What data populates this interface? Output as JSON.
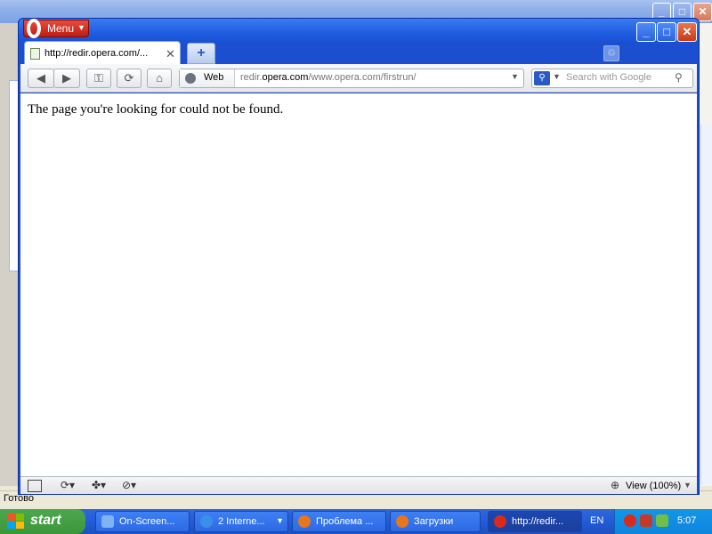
{
  "background_window": {
    "status_text": "Готово"
  },
  "browser": {
    "menu_label": "Menu",
    "tab": {
      "title": "http://redir.opera.com/...",
      "close_glyph": "✕"
    },
    "new_tab_glyph": "+",
    "toolbar": {
      "back_glyph": "◀",
      "forward_glyph": "▶",
      "key_glyph": "⚿",
      "reload_glyph": "⟳",
      "home_glyph": "⌂"
    },
    "address": {
      "scope_label": "Web",
      "url_host": "redir.opera.com",
      "url_path": "/www.opera.com/firstrun/",
      "url_prefix": "redir.",
      "url_domain": "opera.com"
    },
    "search": {
      "placeholder": "Search with Google"
    },
    "page_message": "The page you're looking for could not be found.",
    "status": {
      "zoom_label": "View (100%)"
    }
  },
  "taskbar": {
    "start_label": "start",
    "tasks": [
      {
        "label": "On-Screen...",
        "color": "#7fb3f5"
      },
      {
        "label": "2 Interne...",
        "color": "#3b8fe8"
      },
      {
        "label": "Проблема ...",
        "color": "#e8761b"
      },
      {
        "label": "Загрузки",
        "color": "#e8761b"
      },
      {
        "label": "http://redir...",
        "color": "#d82b1c"
      }
    ],
    "language": "EN",
    "clock": "5:07",
    "colors": {
      "start_green": "#3c973c",
      "taskbar_blue": "#245edb",
      "tray_blue": "#0f85dd"
    }
  },
  "window_controls": {
    "minimize_glyph": "_",
    "maximize_glyph": "□",
    "close_glyph": "✕"
  }
}
